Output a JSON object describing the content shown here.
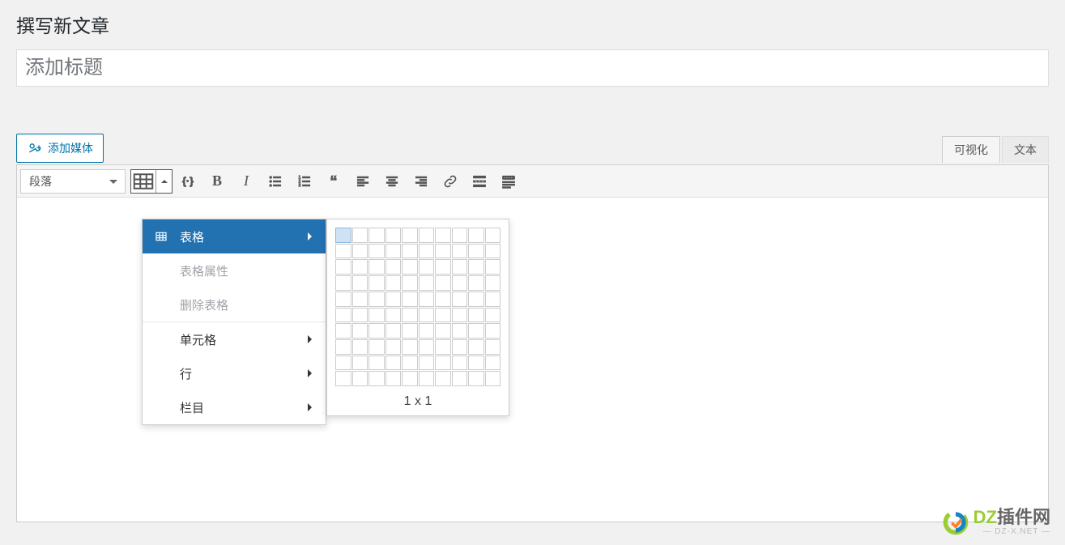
{
  "page": {
    "title": "撰写新文章"
  },
  "title_input": {
    "placeholder": "添加标题",
    "value": ""
  },
  "media_button": {
    "label": "添加媒体"
  },
  "tabs": {
    "visual": "可视化",
    "text": "文本"
  },
  "toolbar": {
    "format_dropdown": "段落",
    "bold": "B",
    "italic": "I"
  },
  "table_menu": {
    "items": [
      {
        "label": "表格",
        "has_sub": true,
        "selected": true,
        "icon": true
      },
      {
        "label": "表格属性",
        "disabled": true
      },
      {
        "label": "删除表格",
        "disabled": true
      }
    ],
    "sep_after": 2,
    "items2": [
      {
        "label": "单元格",
        "has_sub": true
      },
      {
        "label": "行",
        "has_sub": true
      },
      {
        "label": "栏目",
        "has_sub": true
      }
    ]
  },
  "table_picker": {
    "size_label": "1 x 1"
  },
  "watermark": {
    "brand_en": "DZ",
    "brand_cn": "插件网",
    "sub": "— DZ-X.NET —"
  }
}
